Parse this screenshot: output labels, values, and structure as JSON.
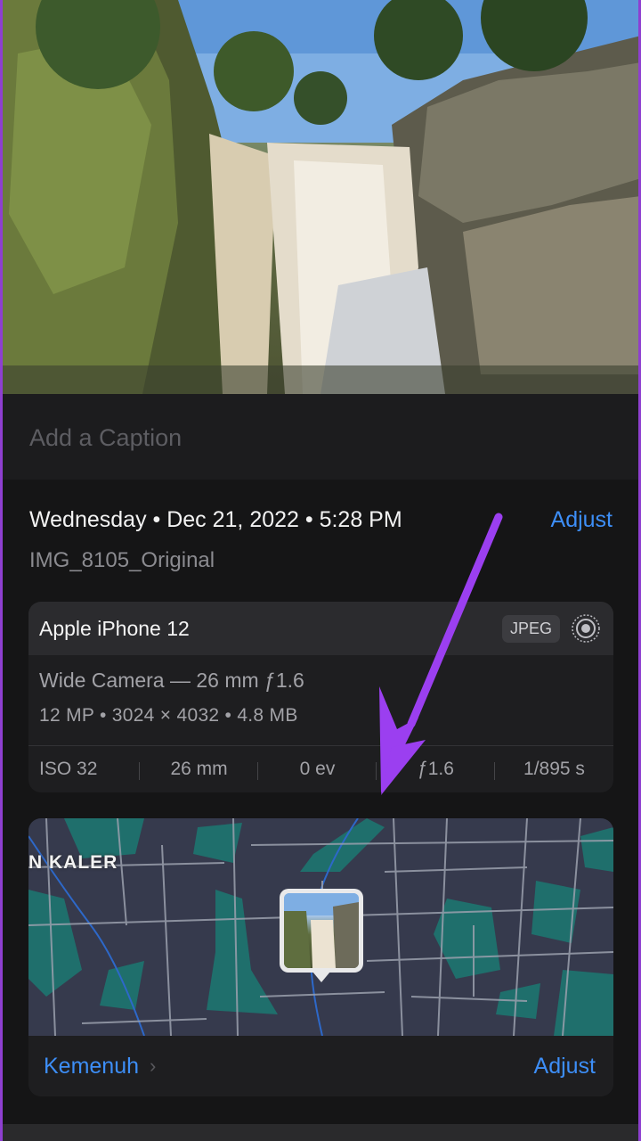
{
  "caption": {
    "placeholder": "Add a Caption"
  },
  "header": {
    "date_line": "Wednesday • Dec 21, 2022 • 5:28 PM",
    "adjust_label": "Adjust",
    "filename": "IMG_8105_Original"
  },
  "device": {
    "name": "Apple iPhone 12",
    "format_badge": "JPEG",
    "live_icon": "live-photo-icon",
    "lens": "Wide Camera — 26 mm ƒ1.6",
    "specs": "12 MP  •  3024 × 4032  •  4.8 MB",
    "exif": [
      "ISO 32",
      "26 mm",
      "0 ev",
      "ƒ1.6",
      "1/895 s"
    ]
  },
  "map": {
    "area_label": "N KALER",
    "place_name": "Kemenuh",
    "adjust_label": "Adjust"
  },
  "colors": {
    "accent": "#3d8ef7",
    "annotation": "#9b3ff0",
    "background": "#151516"
  }
}
